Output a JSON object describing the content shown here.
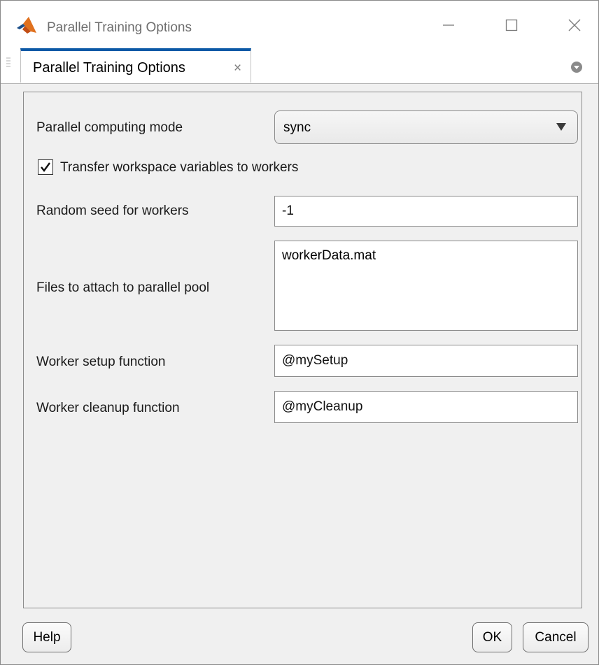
{
  "window": {
    "title": "Parallel Training Options",
    "controls": [
      "minimize-icon",
      "maximize-icon",
      "close-icon"
    ]
  },
  "tab": {
    "label": "Parallel Training Options",
    "close_glyph": "×"
  },
  "form": {
    "mode_label": "Parallel computing mode",
    "mode_value": "sync",
    "transfer_label": "Transfer workspace variables to workers",
    "transfer_checked": true,
    "seed_label": "Random seed for workers",
    "seed_value": "-1",
    "files_label": "Files to attach to parallel pool",
    "files_value": "workerData.mat",
    "setup_label": "Worker setup function",
    "setup_value": "@mySetup",
    "cleanup_label": "Worker cleanup function",
    "cleanup_value": "@myCleanup"
  },
  "buttons": {
    "help": "Help",
    "ok": "OK",
    "cancel": "Cancel"
  },
  "colors": {
    "tab_accent": "#0c59a6",
    "matlab_orange": "#e0711f",
    "matlab_dark": "#1c4f8a"
  }
}
